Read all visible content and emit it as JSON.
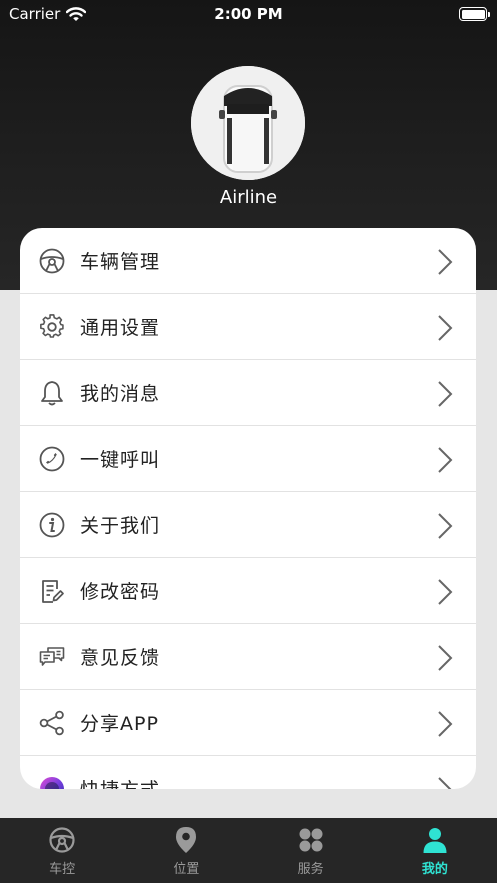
{
  "status_bar": {
    "carrier": "Carrier",
    "time": "2:00 PM"
  },
  "profile": {
    "username": "Airline"
  },
  "menu": {
    "items": [
      {
        "label": "车辆管理",
        "icon": "steering-wheel-icon"
      },
      {
        "label": "通用设置",
        "icon": "gear-icon"
      },
      {
        "label": "我的消息",
        "icon": "bell-icon"
      },
      {
        "label": "一键呼叫",
        "icon": "phone-icon"
      },
      {
        "label": "关于我们",
        "icon": "info-icon"
      },
      {
        "label": "修改密码",
        "icon": "edit-document-icon"
      },
      {
        "label": "意见反馈",
        "icon": "feedback-icon"
      },
      {
        "label": "分享APP",
        "icon": "share-icon"
      },
      {
        "label": "快捷方式",
        "icon": "shortcuts-icon"
      }
    ]
  },
  "tabs": [
    {
      "label": "车控",
      "icon": "steering-wheel-icon",
      "active": false
    },
    {
      "label": "位置",
      "icon": "location-pin-icon",
      "active": false
    },
    {
      "label": "服务",
      "icon": "grid-icon",
      "active": false
    },
    {
      "label": "我的",
      "icon": "person-icon",
      "active": true
    }
  ],
  "colors": {
    "accent": "#2fe3d3",
    "header_bg": "#1c1c1c",
    "tab_bar_bg": "#262626"
  }
}
